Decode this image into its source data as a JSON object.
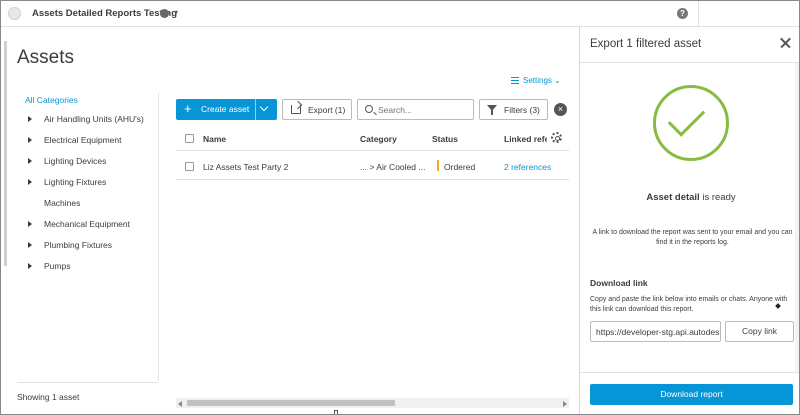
{
  "topbar": {
    "project_name": "Assets Detailed Reports Testing",
    "help_label": "?"
  },
  "page": {
    "title": "Assets",
    "settings_label": "Settings"
  },
  "categories": {
    "all_label": "All Categories",
    "items": [
      {
        "label": "Air Handling Units (AHU's)",
        "expandable": true
      },
      {
        "label": "Electrical Equipment",
        "expandable": true
      },
      {
        "label": "Lighting Devices",
        "expandable": true
      },
      {
        "label": "Lighting Fixtures",
        "expandable": true
      },
      {
        "label": "Machines",
        "expandable": false
      },
      {
        "label": "Mechanical Equipment",
        "expandable": true
      },
      {
        "label": "Plumbing Fixtures",
        "expandable": true
      },
      {
        "label": "Pumps",
        "expandable": true
      }
    ],
    "showing_text": "Showing 1 asset"
  },
  "toolbar": {
    "create_label": "Create asset",
    "export_label": "Export (1)",
    "search_placeholder": "Search...",
    "filters_label": "Filters (3)",
    "clear_label": "×"
  },
  "table": {
    "columns": [
      "Name",
      "Category",
      "Status",
      "Linked refe"
    ],
    "rows": [
      {
        "name": "Liz Assets Test Party 2",
        "category": "... > Air Cooled ...",
        "status": "Ordered",
        "linked": "2 references"
      }
    ],
    "status_color": "#f5a623"
  },
  "panel": {
    "title": "Export 1 filtered asset",
    "ready_bold": "Asset detail",
    "ready_rest": " is ready",
    "message": "A link to download the report was sent to your email and you can find it in the reports log.",
    "download_link_label": "Download link",
    "download_link_desc": "Copy and paste the link below into emails or chats. Anyone with this link can download this report.",
    "url_value": "https://developer-stg.api.autodesk.com",
    "copy_label": "Copy link",
    "download_button": "Download report"
  },
  "colors": {
    "accent": "#0696d7",
    "success": "#87bc40"
  }
}
